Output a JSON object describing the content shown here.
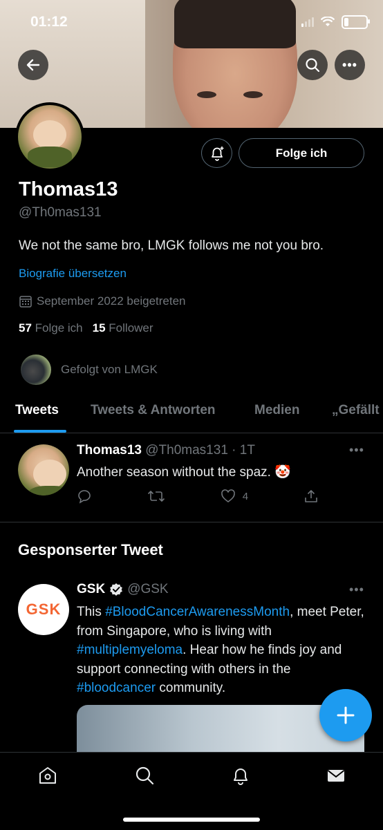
{
  "status_bar": {
    "time": "01:12",
    "battery_level": 0.2
  },
  "profile": {
    "name": "Thomas13",
    "handle": "@Th0mas131",
    "bio": "We not the same bro, LMGK follows me not you bro.",
    "translate_label": "Biografie übersetzen",
    "joined": "September 2022 beigetreten",
    "following_count": "57",
    "following_label": "Folge ich",
    "followers_count": "15",
    "followers_label": "Follower",
    "followed_by": "Gefolgt von LMGK",
    "follow_button_label": "Folge ich"
  },
  "tabs": [
    {
      "label": "Tweets"
    },
    {
      "label": "Tweets & Antworten"
    },
    {
      "label": "Medien"
    },
    {
      "label": "„Gefällt"
    }
  ],
  "tweet": {
    "name": "Thomas13",
    "meta": "@Th0mas131 · 1T",
    "text": "Another season without the spaz. 🤡",
    "likes": "4"
  },
  "sponsored": {
    "heading": "Gesponserter Tweet",
    "avatar_text": "GSK",
    "name": "GSK",
    "handle": "@GSK",
    "text_parts": [
      "This ",
      "#BloodCancerAwarenessMonth",
      ", meet Peter, from Singapore, who is living with ",
      "#multiplemyeloma",
      ". Hear how he finds joy and support connecting with others in the ",
      "#bloodcancer",
      " community."
    ]
  },
  "colors": {
    "accent": "#1d9bf0",
    "muted": "#71767b",
    "background": "#000000",
    "gsk_orange": "#f36633"
  },
  "icons": [
    "back-arrow-icon",
    "search-icon",
    "more-icon",
    "bell-plus-icon",
    "calendar-icon",
    "reply-icon",
    "retweet-icon",
    "heart-icon",
    "share-icon",
    "verified-icon",
    "plus-icon",
    "home-icon",
    "notifications-icon",
    "messages-icon"
  ]
}
